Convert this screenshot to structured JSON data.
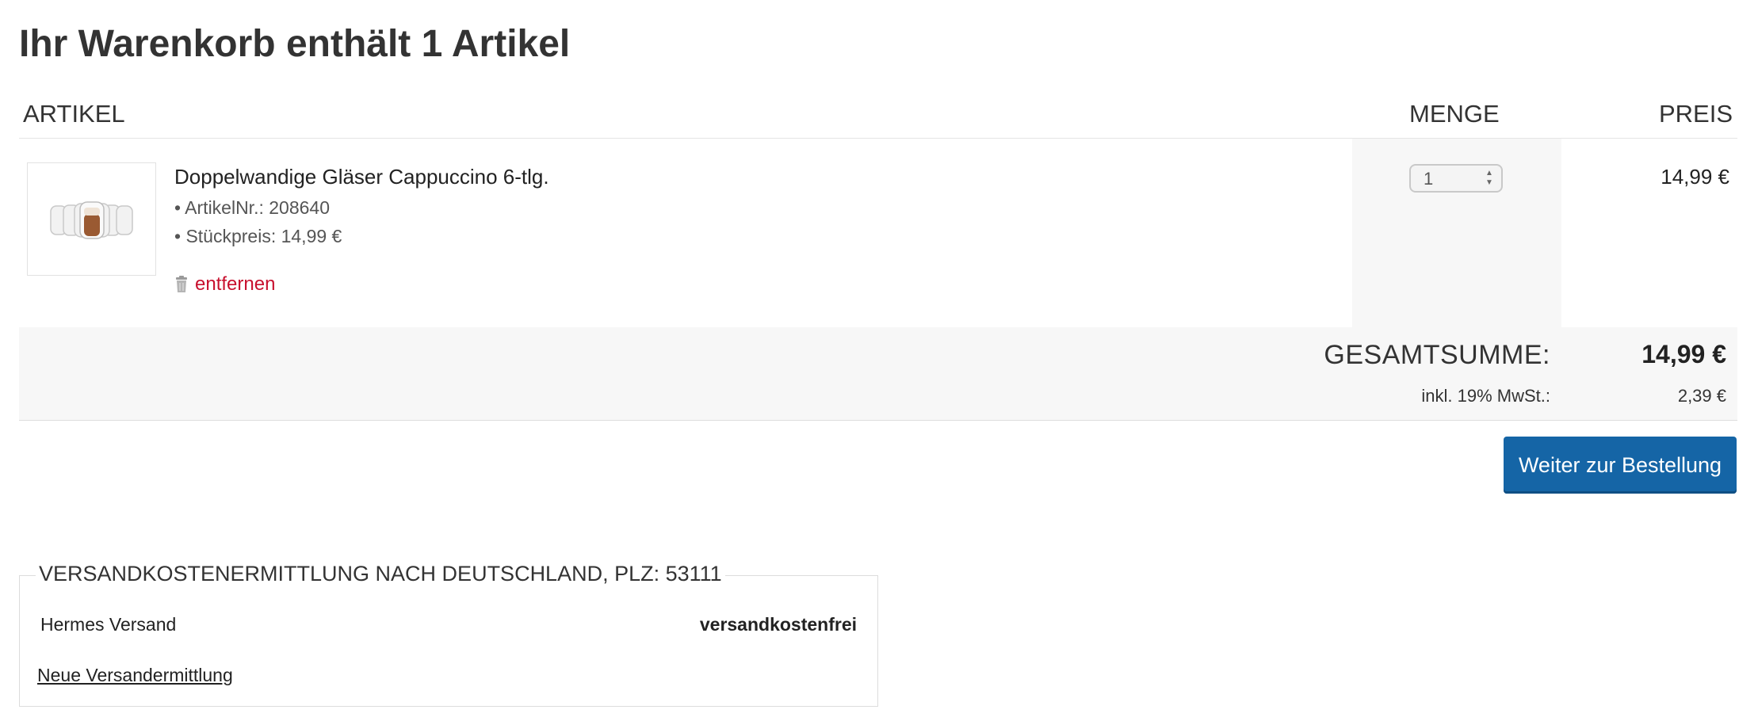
{
  "page": {
    "title": "Ihr Warenkorb enthält 1 Artikel"
  },
  "cart": {
    "columns": {
      "article": "ARTIKEL",
      "quantity": "MENGE",
      "price": "PREIS"
    },
    "items": [
      {
        "name": "Doppelwandige Gläser Cappuccino 6-tlg.",
        "article_no": "• ArtikelNr.: 208640",
        "unit_price": "• Stückpreis: 14,99 €",
        "remove_label": "entfernen",
        "quantity": "1",
        "price": "14,99 €"
      }
    ]
  },
  "totals": {
    "total_label": "GESAMTSUMME:",
    "total_value": "14,99 €",
    "vat_label": "inkl. 19% MwSt.:",
    "vat_value": "2,39 €"
  },
  "actions": {
    "continue_label": "Weiter zur Bestellung"
  },
  "shipping": {
    "legend": "VERSANDKOSTENERMITTLUNG NACH DEUTSCHLAND, PLZ: 53111",
    "method": "Hermes Versand",
    "cost": "versandkostenfrei",
    "recalc_label": "Neue Versandermittlung"
  },
  "colors": {
    "accent_button": "#1565a6",
    "remove_link": "#c8102e",
    "panel_background": "#f7f7f7"
  },
  "icons": {
    "trash": "trash-icon",
    "spinner": "spinner-arrows-icon"
  }
}
